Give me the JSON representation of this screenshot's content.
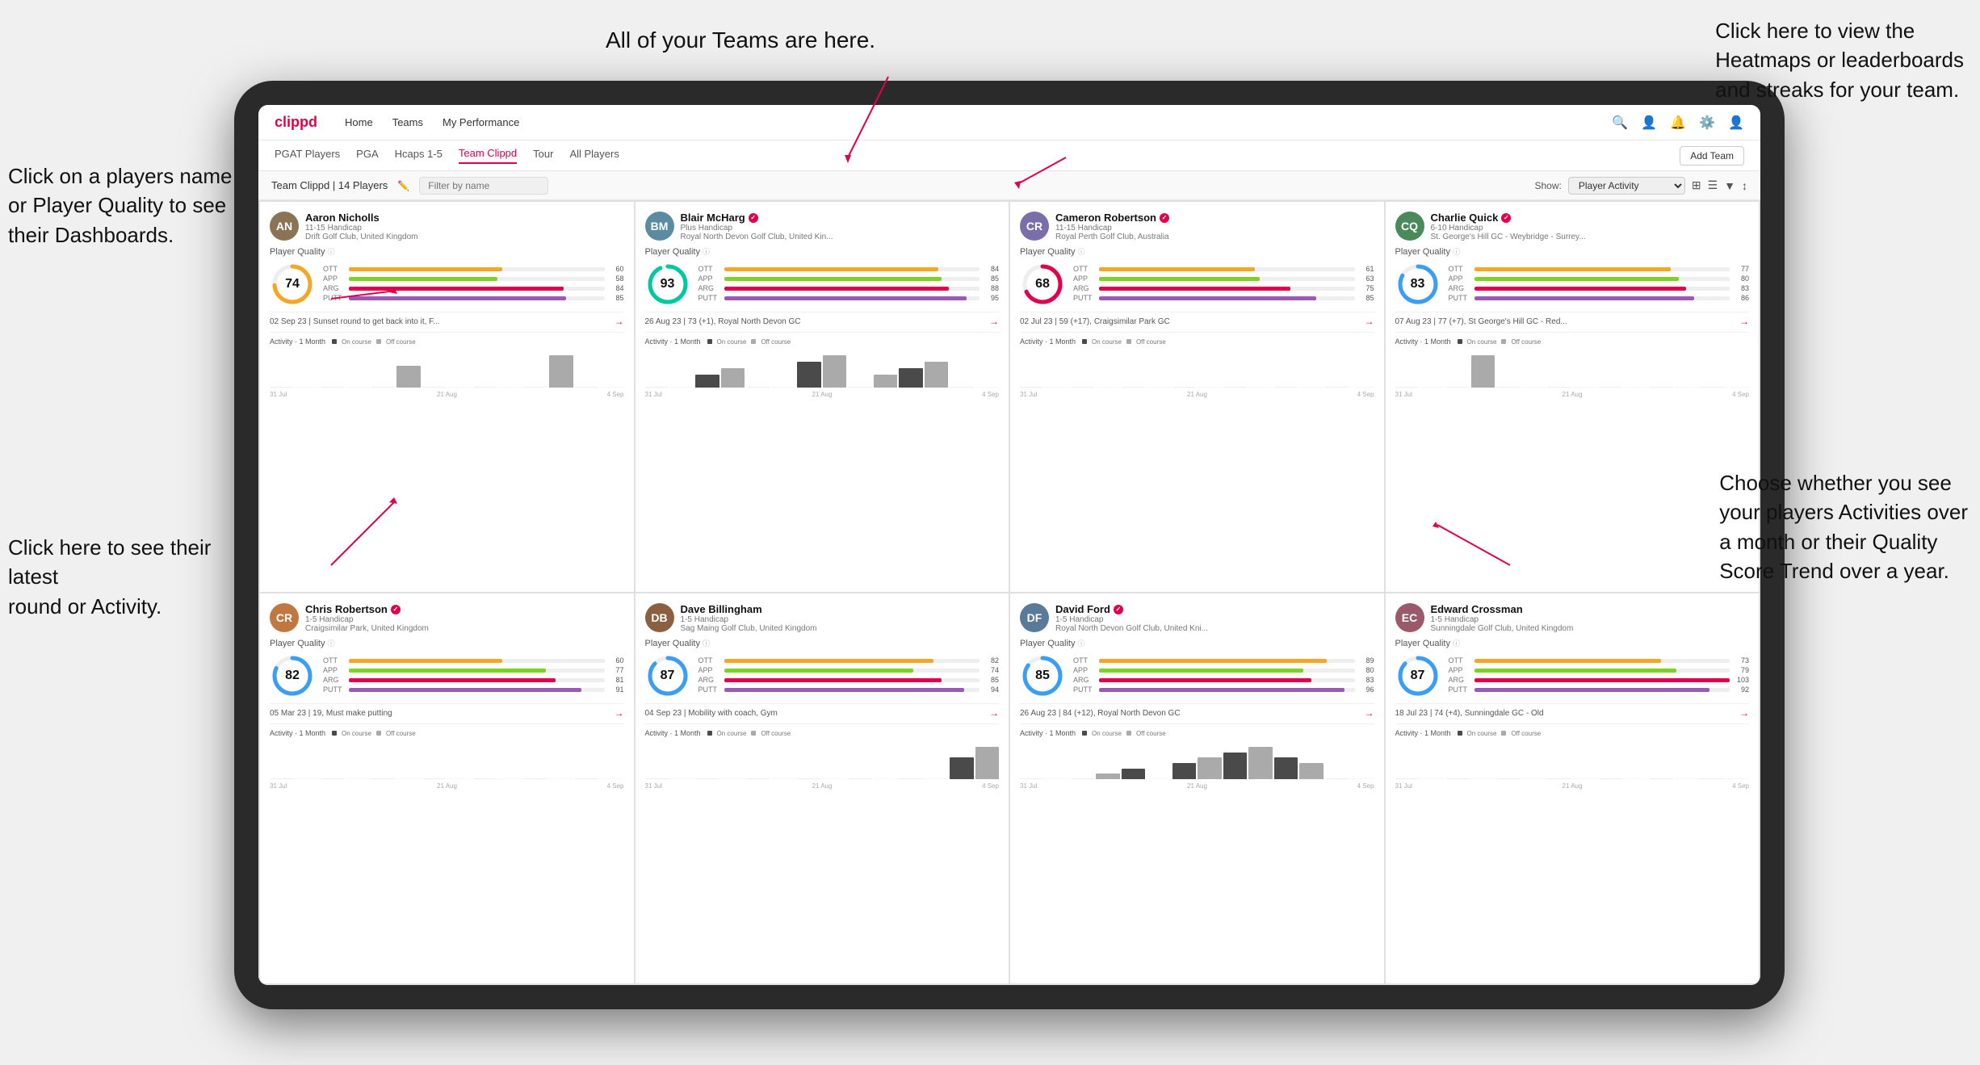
{
  "annotations": {
    "top_center": "All of your Teams are here.",
    "top_right": "Click here to view the\nHeatmaps or leaderboards\nand streaks for your team.",
    "left_top": "Click on a players name\nor Player Quality to see\ntheir Dashboards.",
    "left_bottom": "Click here to see their latest\nround or Activity.",
    "right_bottom": "Choose whether you see\nyour players Activities over\na month or their Quality\nScore Trend over a year."
  },
  "nav": {
    "logo": "clippd",
    "links": [
      "Home",
      "Teams",
      "My Performance"
    ],
    "add_team": "Add Team"
  },
  "sub_tabs": [
    "PGAT Players",
    "PGA",
    "Hcaps 1-5",
    "Team Clippd",
    "Tour",
    "All Players"
  ],
  "active_tab": "Team Clippd",
  "team_label": "Team Clippd | 14 Players",
  "show_label": "Show:",
  "show_value": "Player Activity",
  "search_placeholder": "Filter by name",
  "players": [
    {
      "name": "Aaron Nicholls",
      "handicap": "11-15 Handicap",
      "club": "Drift Golf Club, United Kingdom",
      "quality": 74,
      "stats": {
        "OTT": 60,
        "APP": 58,
        "ARG": 84,
        "PUTT": 85
      },
      "latest_round": "02 Sep 23 | Sunset round to get back into it, F...",
      "avatar_color": "av-1",
      "avatar_letter": "AN",
      "activity_bars": [
        0,
        0,
        0,
        0,
        0,
        2,
        0,
        0,
        0,
        0,
        0,
        3,
        0,
        0
      ],
      "chart_dates": [
        "31 Jul",
        "21 Aug",
        "4 Sep"
      ]
    },
    {
      "name": "Blair McHarg",
      "handicap": "Plus Handicap",
      "club": "Royal North Devon Golf Club, United Kin...",
      "quality": 93,
      "stats": {
        "OTT": 84,
        "APP": 85,
        "ARG": 88,
        "PUTT": 95
      },
      "latest_round": "26 Aug 23 | 73 (+1), Royal North Devon GC",
      "avatar_color": "av-2",
      "avatar_letter": "BM",
      "activity_bars": [
        0,
        0,
        2,
        3,
        0,
        0,
        4,
        5,
        0,
        2,
        3,
        4,
        0,
        0
      ],
      "chart_dates": [
        "31 Jul",
        "21 Aug",
        "4 Sep"
      ]
    },
    {
      "name": "Cameron Robertson",
      "handicap": "11-15 Handicap",
      "club": "Royal Perth Golf Club, Australia",
      "quality": 68,
      "stats": {
        "OTT": 61,
        "APP": 63,
        "ARG": 75,
        "PUTT": 85
      },
      "latest_round": "02 Jul 23 | 59 (+17), Craigsimilar Park GC",
      "avatar_color": "av-3",
      "avatar_letter": "CR",
      "activity_bars": [
        0,
        0,
        0,
        0,
        0,
        0,
        0,
        0,
        0,
        0,
        0,
        0,
        0,
        0
      ],
      "chart_dates": [
        "31 Jul",
        "21 Aug",
        "4 Sep"
      ]
    },
    {
      "name": "Charlie Quick",
      "handicap": "6-10 Handicap",
      "club": "St. George's Hill GC - Weybridge - Surrey...",
      "quality": 83,
      "stats": {
        "OTT": 77,
        "APP": 80,
        "ARG": 83,
        "PUTT": 86
      },
      "latest_round": "07 Aug 23 | 77 (+7), St George's Hill GC - Red...",
      "avatar_color": "av-4",
      "avatar_letter": "CQ",
      "activity_bars": [
        0,
        0,
        0,
        2,
        0,
        0,
        0,
        0,
        0,
        0,
        0,
        0,
        0,
        0
      ],
      "chart_dates": [
        "31 Jul",
        "21 Aug",
        "4 Sep"
      ]
    },
    {
      "name": "Chris Robertson",
      "handicap": "1-5 Handicap",
      "club": "Craigsimilar Park, United Kingdom",
      "quality": 82,
      "stats": {
        "OTT": 60,
        "APP": 77,
        "ARG": 81,
        "PUTT": 91
      },
      "latest_round": "05 Mar 23 | 19, Must make putting",
      "avatar_color": "av-5",
      "avatar_letter": "CR",
      "activity_bars": [
        0,
        0,
        0,
        0,
        0,
        0,
        0,
        0,
        0,
        0,
        0,
        0,
        0,
        0
      ],
      "chart_dates": [
        "31 Jul",
        "21 Aug",
        "4 Sep"
      ]
    },
    {
      "name": "Dave Billingham",
      "handicap": "1-5 Handicap",
      "club": "Sag Maing Golf Club, United Kingdom",
      "quality": 87,
      "stats": {
        "OTT": 82,
        "APP": 74,
        "ARG": 85,
        "PUTT": 94
      },
      "latest_round": "04 Sep 23 | Mobility with coach, Gym",
      "avatar_color": "av-6",
      "avatar_letter": "DB",
      "activity_bars": [
        0,
        0,
        0,
        0,
        0,
        0,
        0,
        0,
        0,
        0,
        0,
        0,
        2,
        3
      ],
      "chart_dates": [
        "31 Jul",
        "21 Aug",
        "4 Sep"
      ]
    },
    {
      "name": "David Ford",
      "handicap": "1-5 Handicap",
      "club": "Royal North Devon Golf Club, United Kni...",
      "quality": 85,
      "stats": {
        "OTT": 89,
        "APP": 80,
        "ARG": 83,
        "PUTT": 96
      },
      "latest_round": "26 Aug 23 | 84 (+12), Royal North Devon GC",
      "avatar_color": "av-7",
      "avatar_letter": "DF",
      "activity_bars": [
        0,
        0,
        0,
        1,
        2,
        0,
        3,
        4,
        5,
        6,
        4,
        3,
        0,
        0
      ],
      "chart_dates": [
        "31 Jul",
        "21 Aug",
        "4 Sep"
      ]
    },
    {
      "name": "Edward Crossman",
      "handicap": "1-5 Handicap",
      "club": "Sunningdale Golf Club, United Kingdom",
      "quality": 87,
      "stats": {
        "OTT": 73,
        "APP": 79,
        "ARG": 103,
        "PUTT": 92
      },
      "latest_round": "18 Jul 23 | 74 (+4), Sunningdale GC - Old",
      "avatar_color": "av-8",
      "avatar_letter": "EC",
      "activity_bars": [
        0,
        0,
        0,
        0,
        0,
        0,
        0,
        0,
        0,
        0,
        0,
        0,
        0,
        0
      ],
      "chart_dates": [
        "31 Jul",
        "21 Aug",
        "4 Sep"
      ]
    }
  ]
}
